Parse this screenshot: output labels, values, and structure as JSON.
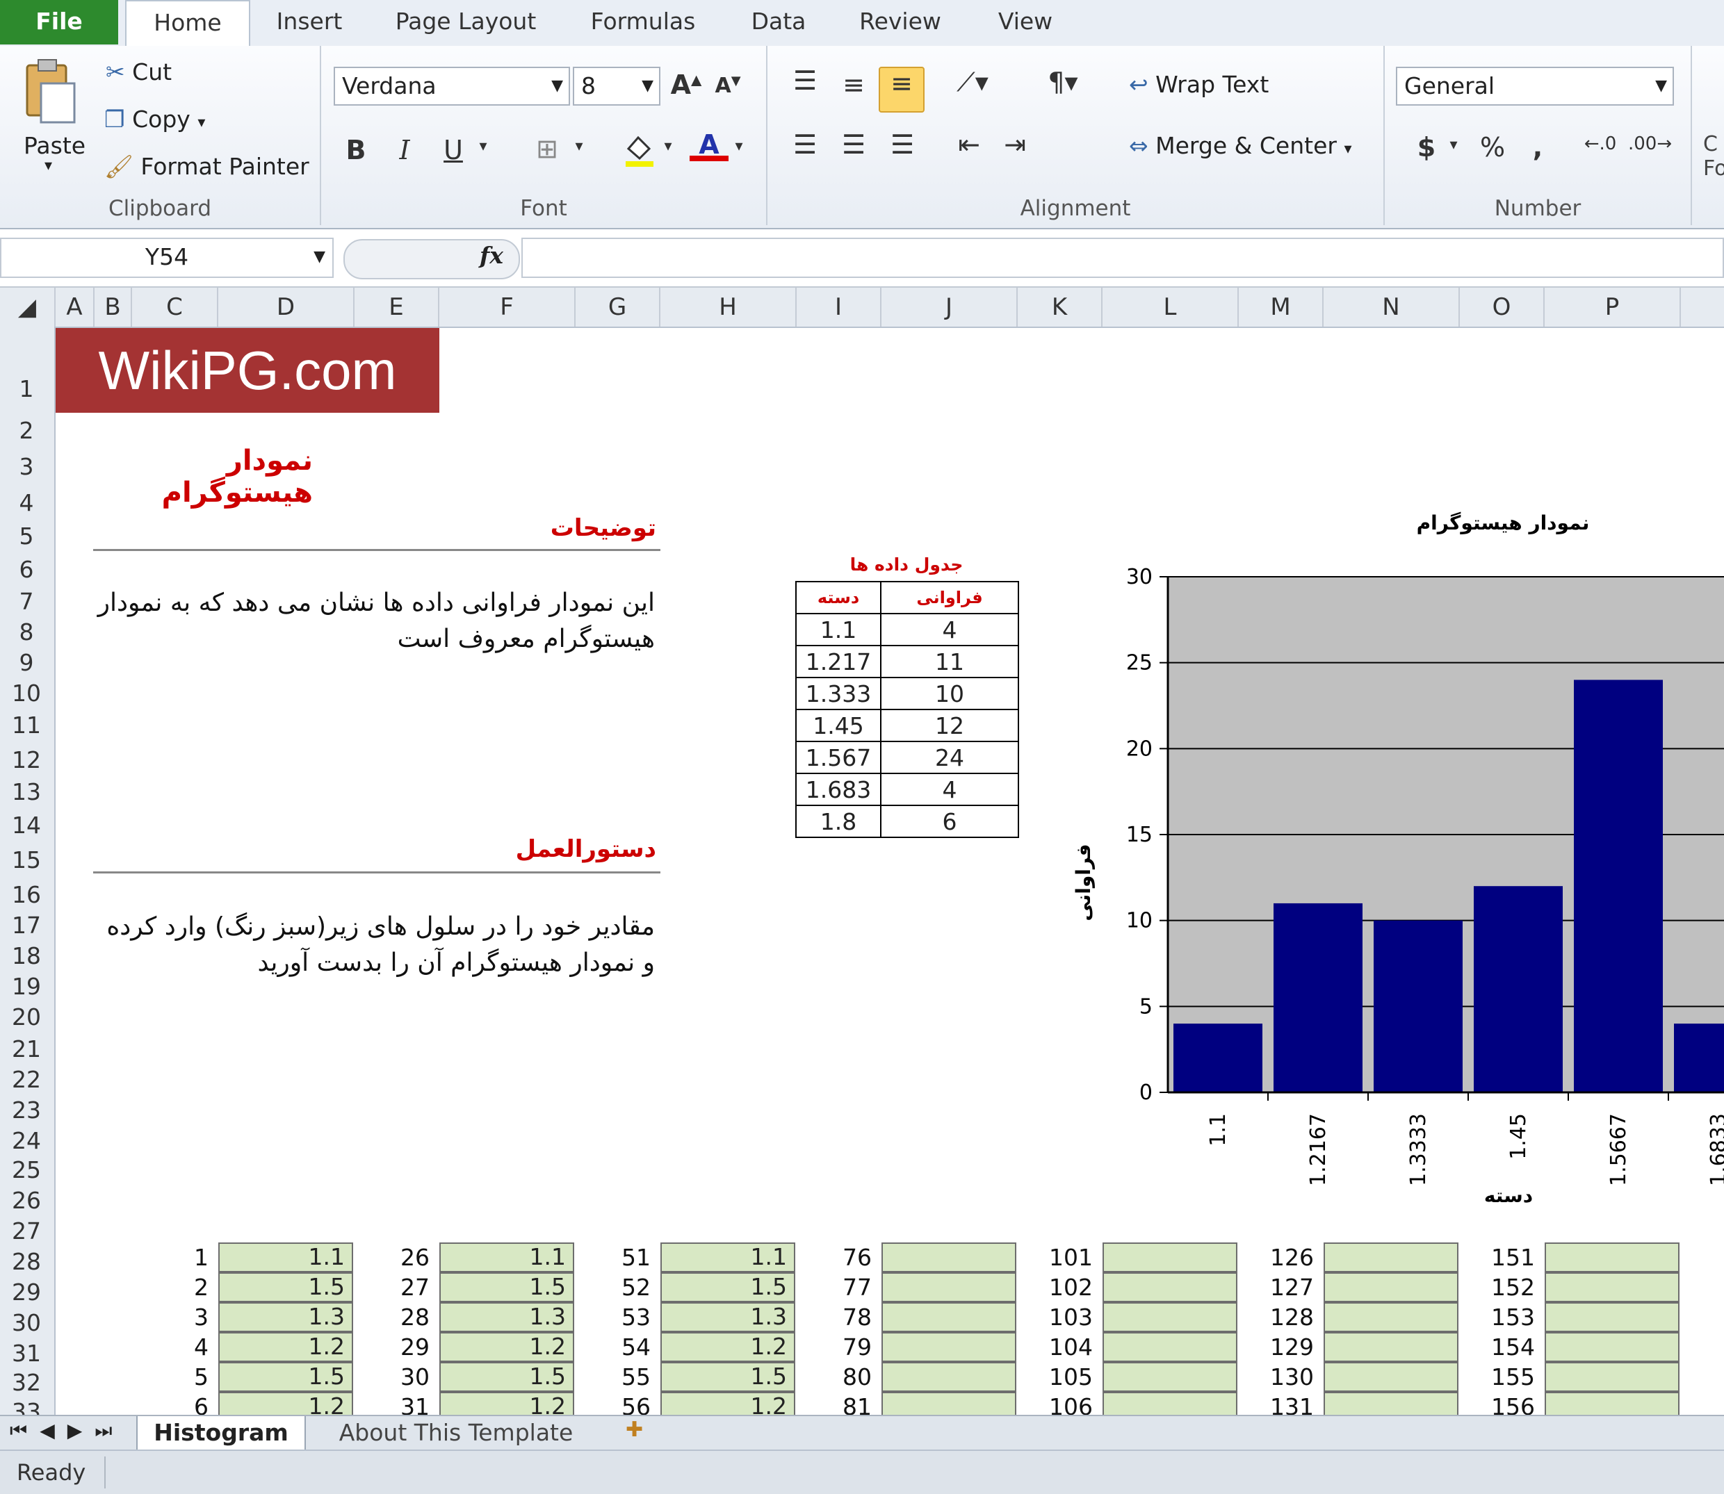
{
  "ribbon": {
    "tabs": [
      "File",
      "Home",
      "Insert",
      "Page Layout",
      "Formulas",
      "Data",
      "Review",
      "View"
    ],
    "clipboard": {
      "paste": "Paste",
      "cut": "Cut",
      "copy": "Copy",
      "format_painter": "Format Painter",
      "label": "Clipboard"
    },
    "font": {
      "name": "Verdana",
      "size": "8",
      "label": "Font",
      "bold": "B",
      "italic": "I",
      "underline": "U"
    },
    "alignment": {
      "wrap": "Wrap Text",
      "merge": "Merge & Center",
      "label": "Alignment"
    },
    "number": {
      "format": "General",
      "label": "Number",
      "currency": "$",
      "percent": "%",
      "comma": ","
    }
  },
  "formula_bar": {
    "name_box": "Y54",
    "fx": "fx",
    "value": ""
  },
  "columns": [
    "A",
    "B",
    "C",
    "D",
    "E",
    "F",
    "G",
    "H",
    "I",
    "J",
    "K",
    "L",
    "M",
    "N",
    "O",
    "P"
  ],
  "rows": [
    "1",
    "2",
    "3",
    "4",
    "5",
    "6",
    "7",
    "8",
    "9",
    "10",
    "11",
    "12",
    "13",
    "14",
    "15",
    "16",
    "17",
    "18",
    "19",
    "20",
    "21",
    "22",
    "23",
    "24",
    "25",
    "26",
    "27",
    "28",
    "29",
    "30",
    "31",
    "32",
    "33"
  ],
  "sheet": {
    "logo": "WikiPG.com",
    "title": "نمودار هیستوگرام",
    "desc_heading": "توضیحات",
    "desc_text": "این نمودار فراوانی داده ها نشان می دهد که به نمودار هیستوگرام معروف است",
    "instr_heading": "دستورالعمل",
    "instr_text": "مقادیر خود را در سلول های زیر(سبز رنگ) وارد کرده و نمودار هیستوگرام آن را بدست آورید",
    "table_title": "جدول داده ها",
    "table_headers": [
      "دسته",
      "فراوانی"
    ],
    "table_rows": [
      [
        "1.1",
        "4"
      ],
      [
        "1.217",
        "11"
      ],
      [
        "1.333",
        "10"
      ],
      [
        "1.45",
        "12"
      ],
      [
        "1.567",
        "24"
      ],
      [
        "1.683",
        "4"
      ],
      [
        "1.8",
        "6"
      ]
    ]
  },
  "entry_blocks": [
    {
      "nums": [
        "1",
        "2",
        "3",
        "4",
        "5",
        "6"
      ],
      "vals": [
        "1.1",
        "1.5",
        "1.3",
        "1.2",
        "1.5",
        "1.2"
      ]
    },
    {
      "nums": [
        "26",
        "27",
        "28",
        "29",
        "30",
        "31"
      ],
      "vals": [
        "1.1",
        "1.5",
        "1.3",
        "1.2",
        "1.5",
        "1.2"
      ]
    },
    {
      "nums": [
        "51",
        "52",
        "53",
        "54",
        "55",
        "56"
      ],
      "vals": [
        "1.1",
        "1.5",
        "1.3",
        "1.2",
        "1.5",
        "1.2"
      ]
    },
    {
      "nums": [
        "76",
        "77",
        "78",
        "79",
        "80",
        "81"
      ],
      "vals": [
        "",
        "",
        "",
        "",
        "",
        ""
      ]
    },
    {
      "nums": [
        "101",
        "102",
        "103",
        "104",
        "105",
        "106"
      ],
      "vals": [
        "",
        "",
        "",
        "",
        "",
        ""
      ]
    },
    {
      "nums": [
        "126",
        "127",
        "128",
        "129",
        "130",
        "131"
      ],
      "vals": [
        "",
        "",
        "",
        "",
        "",
        ""
      ]
    },
    {
      "nums": [
        "151",
        "152",
        "153",
        "154",
        "155",
        "156"
      ],
      "vals": [
        "",
        "",
        "",
        "",
        "",
        ""
      ]
    }
  ],
  "chart_data": {
    "type": "bar",
    "title": "نمودار هیستوگرام",
    "xlabel": "دسته",
    "ylabel": "فراوانی",
    "categories": [
      "1.1",
      "1.2167",
      "1.3333",
      "1.45",
      "1.5667",
      "1.6833"
    ],
    "values": [
      4,
      11,
      10,
      12,
      24,
      4
    ],
    "ylim": [
      0,
      30
    ],
    "yticks": [
      "0",
      "5",
      "10",
      "15",
      "20",
      "25",
      "30"
    ],
    "bar_color": "#000080",
    "plot_bg": "#c0c0c0"
  },
  "sheet_tabs": [
    "Histogram",
    "About This Template"
  ],
  "status": "Ready",
  "colors": {
    "accent_green": "#2d8a2d",
    "logo_bg": "#a43333",
    "entry_fill": "#d8e8c4",
    "heading_red": "#cc0000"
  }
}
